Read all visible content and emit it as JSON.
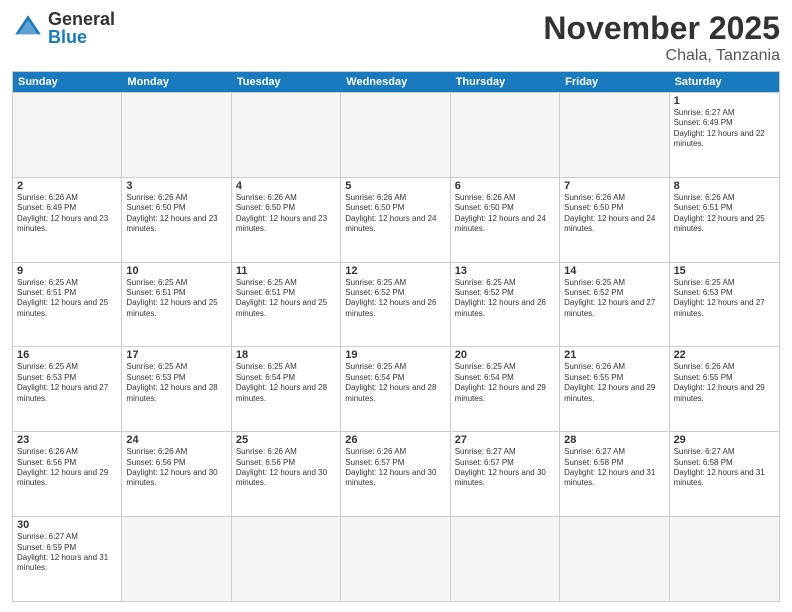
{
  "header": {
    "logo_general": "General",
    "logo_blue": "Blue",
    "month_title": "November 2025",
    "location": "Chala, Tanzania"
  },
  "days_of_week": [
    "Sunday",
    "Monday",
    "Tuesday",
    "Wednesday",
    "Thursday",
    "Friday",
    "Saturday"
  ],
  "weeks": [
    [
      {
        "day": "",
        "empty": true
      },
      {
        "day": "",
        "empty": true
      },
      {
        "day": "",
        "empty": true
      },
      {
        "day": "",
        "empty": true
      },
      {
        "day": "",
        "empty": true
      },
      {
        "day": "",
        "empty": true
      },
      {
        "day": "1",
        "sunrise": "6:27 AM",
        "sunset": "6:49 PM",
        "daylight": "12 hours and 22 minutes."
      }
    ],
    [
      {
        "day": "2",
        "sunrise": "6:26 AM",
        "sunset": "6:49 PM",
        "daylight": "12 hours and 23 minutes."
      },
      {
        "day": "3",
        "sunrise": "6:26 AM",
        "sunset": "6:50 PM",
        "daylight": "12 hours and 23 minutes."
      },
      {
        "day": "4",
        "sunrise": "6:26 AM",
        "sunset": "6:50 PM",
        "daylight": "12 hours and 23 minutes."
      },
      {
        "day": "5",
        "sunrise": "6:26 AM",
        "sunset": "6:50 PM",
        "daylight": "12 hours and 24 minutes."
      },
      {
        "day": "6",
        "sunrise": "6:26 AM",
        "sunset": "6:50 PM",
        "daylight": "12 hours and 24 minutes."
      },
      {
        "day": "7",
        "sunrise": "6:26 AM",
        "sunset": "6:50 PM",
        "daylight": "12 hours and 24 minutes."
      },
      {
        "day": "8",
        "sunrise": "6:26 AM",
        "sunset": "6:51 PM",
        "daylight": "12 hours and 25 minutes."
      }
    ],
    [
      {
        "day": "9",
        "sunrise": "6:25 AM",
        "sunset": "6:51 PM",
        "daylight": "12 hours and 25 minutes."
      },
      {
        "day": "10",
        "sunrise": "6:25 AM",
        "sunset": "6:51 PM",
        "daylight": "12 hours and 25 minutes."
      },
      {
        "day": "11",
        "sunrise": "6:25 AM",
        "sunset": "6:51 PM",
        "daylight": "12 hours and 25 minutes."
      },
      {
        "day": "12",
        "sunrise": "6:25 AM",
        "sunset": "6:52 PM",
        "daylight": "12 hours and 26 minutes."
      },
      {
        "day": "13",
        "sunrise": "6:25 AM",
        "sunset": "6:52 PM",
        "daylight": "12 hours and 26 minutes."
      },
      {
        "day": "14",
        "sunrise": "6:25 AM",
        "sunset": "6:52 PM",
        "daylight": "12 hours and 27 minutes."
      },
      {
        "day": "15",
        "sunrise": "6:25 AM",
        "sunset": "6:53 PM",
        "daylight": "12 hours and 27 minutes."
      }
    ],
    [
      {
        "day": "16",
        "sunrise": "6:25 AM",
        "sunset": "6:53 PM",
        "daylight": "12 hours and 27 minutes."
      },
      {
        "day": "17",
        "sunrise": "6:25 AM",
        "sunset": "6:53 PM",
        "daylight": "12 hours and 28 minutes."
      },
      {
        "day": "18",
        "sunrise": "6:25 AM",
        "sunset": "6:54 PM",
        "daylight": "12 hours and 28 minutes."
      },
      {
        "day": "19",
        "sunrise": "6:25 AM",
        "sunset": "6:54 PM",
        "daylight": "12 hours and 28 minutes."
      },
      {
        "day": "20",
        "sunrise": "6:25 AM",
        "sunset": "6:54 PM",
        "daylight": "12 hours and 29 minutes."
      },
      {
        "day": "21",
        "sunrise": "6:26 AM",
        "sunset": "6:55 PM",
        "daylight": "12 hours and 29 minutes."
      },
      {
        "day": "22",
        "sunrise": "6:26 AM",
        "sunset": "6:55 PM",
        "daylight": "12 hours and 29 minutes."
      }
    ],
    [
      {
        "day": "23",
        "sunrise": "6:26 AM",
        "sunset": "6:56 PM",
        "daylight": "12 hours and 29 minutes."
      },
      {
        "day": "24",
        "sunrise": "6:26 AM",
        "sunset": "6:56 PM",
        "daylight": "12 hours and 30 minutes."
      },
      {
        "day": "25",
        "sunrise": "6:26 AM",
        "sunset": "6:56 PM",
        "daylight": "12 hours and 30 minutes."
      },
      {
        "day": "26",
        "sunrise": "6:26 AM",
        "sunset": "6:57 PM",
        "daylight": "12 hours and 30 minutes."
      },
      {
        "day": "27",
        "sunrise": "6:27 AM",
        "sunset": "6:57 PM",
        "daylight": "12 hours and 30 minutes."
      },
      {
        "day": "28",
        "sunrise": "6:27 AM",
        "sunset": "6:58 PM",
        "daylight": "12 hours and 31 minutes."
      },
      {
        "day": "29",
        "sunrise": "6:27 AM",
        "sunset": "6:58 PM",
        "daylight": "12 hours and 31 minutes."
      }
    ],
    [
      {
        "day": "30",
        "sunrise": "6:27 AM",
        "sunset": "6:59 PM",
        "daylight": "12 hours and 31 minutes."
      },
      {
        "day": "",
        "empty": true
      },
      {
        "day": "",
        "empty": true
      },
      {
        "day": "",
        "empty": true
      },
      {
        "day": "",
        "empty": true
      },
      {
        "day": "",
        "empty": true
      },
      {
        "day": "",
        "empty": true
      }
    ]
  ]
}
